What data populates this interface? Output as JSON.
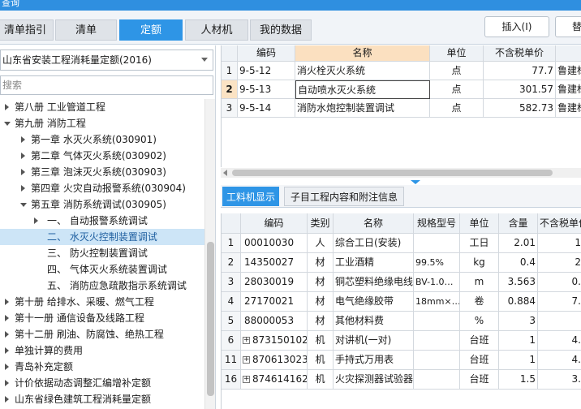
{
  "window": {
    "title": "查询"
  },
  "tabs": [
    {
      "label": "清单指引"
    },
    {
      "label": "清单"
    },
    {
      "label": "定额"
    },
    {
      "label": "人材机"
    },
    {
      "label": "我的数据"
    }
  ],
  "toolbar": {
    "insert_label": "插入(I)",
    "replace_label": "替"
  },
  "left": {
    "quota_select": "山东省安装工程消耗量定额(2016)",
    "search_placeholder": "搜索",
    "tree": [
      {
        "label": "第八册 工业管道工程"
      },
      {
        "label": "第九册 消防工程"
      },
      {
        "label": "第一章 水灭火系统(030901)"
      },
      {
        "label": "第二章 气体灭火系统(030902)"
      },
      {
        "label": "第三章 泡沫灭火系统(030903)"
      },
      {
        "label": "第四章 火灾自动报警系统(030904)"
      },
      {
        "label": "第五章 消防系统调试(030905)"
      },
      {
        "label": "一、  自动报警系统调试"
      },
      {
        "label": "二、  水灭火控制装置调试"
      },
      {
        "label": "三、  防火控制装置调试"
      },
      {
        "label": "四、  气体灭火系统装置调试"
      },
      {
        "label": "五、  消防应急疏散指示系统调试"
      },
      {
        "label": "第十册 给排水、采暖、燃气工程"
      },
      {
        "label": "第十一册 通信设备及线路工程"
      },
      {
        "label": "第十二册 刷油、防腐蚀、绝热工程"
      },
      {
        "label": "单独计算的费用"
      },
      {
        "label": "青岛补充定额"
      },
      {
        "label": "计价依据动态调整汇编增补定额"
      },
      {
        "label": "山东省绿色建筑工程消耗量定额"
      }
    ]
  },
  "quota_table": {
    "columns": [
      "编码",
      "名称",
      "单位",
      "不含税单价",
      ""
    ],
    "rows": [
      {
        "no": "1",
        "code": "9-5-12",
        "name": "消火栓灭火系统",
        "unit": "点",
        "price": "77.7",
        "extra": "鲁建标"
      },
      {
        "no": "2",
        "code": "9-5-13",
        "name": "自动喷水灭火系统",
        "unit": "点",
        "price": "301.57",
        "extra": "鲁建标"
      },
      {
        "no": "3",
        "code": "9-5-14",
        "name": "消防水炮控制装置调试",
        "unit": "点",
        "price": "582.73",
        "extra": "鲁建标"
      }
    ]
  },
  "bottom_tabs": [
    {
      "label": "工料机显示"
    },
    {
      "label": "子目工程内容和附注信息"
    }
  ],
  "material_table": {
    "columns": [
      "编码",
      "类别",
      "名称",
      "规格型号",
      "单位",
      "含量",
      "不含税单价"
    ],
    "rows": [
      {
        "no": "1",
        "code": "00010030",
        "type": "人",
        "name": "综合工日(安装)",
        "spec": "",
        "unit": "工日",
        "qty": "2.01",
        "price": "1"
      },
      {
        "no": "2",
        "code": "14350027",
        "type": "材",
        "name": "工业酒精",
        "spec": "99.5%",
        "unit": "kg",
        "qty": "0.4",
        "price": "2"
      },
      {
        "no": "3",
        "code": "28030019",
        "type": "材",
        "name": "铜芯塑料绝缘电线",
        "spec": "BV-1.0…",
        "unit": "m",
        "qty": "3.563",
        "price": "0."
      },
      {
        "no": "4",
        "code": "27170021",
        "type": "材",
        "name": "电气绝缘胶带",
        "spec": "18mm×…",
        "unit": "卷",
        "qty": "0.884",
        "price": "7."
      },
      {
        "no": "5",
        "code": "88000053",
        "type": "材",
        "name": "其他材料费",
        "spec": "",
        "unit": "%",
        "qty": "3",
        "price": ""
      },
      {
        "no": "6",
        "code": "873150102",
        "type": "机",
        "name": "对讲机(一对)",
        "spec": "",
        "unit": "台班",
        "qty": "1",
        "price": "4.",
        "plus": "+"
      },
      {
        "no": "11",
        "code": "870613023",
        "type": "机",
        "name": "手持式万用表",
        "spec": "",
        "unit": "台班",
        "qty": "1",
        "price": "4.",
        "plus": "+"
      },
      {
        "no": "16",
        "code": "874614162",
        "type": "机",
        "name": "火灾探测器试验器",
        "spec": "",
        "unit": "台班",
        "qty": "1.5",
        "price": "3.",
        "plus": "+"
      }
    ]
  }
}
